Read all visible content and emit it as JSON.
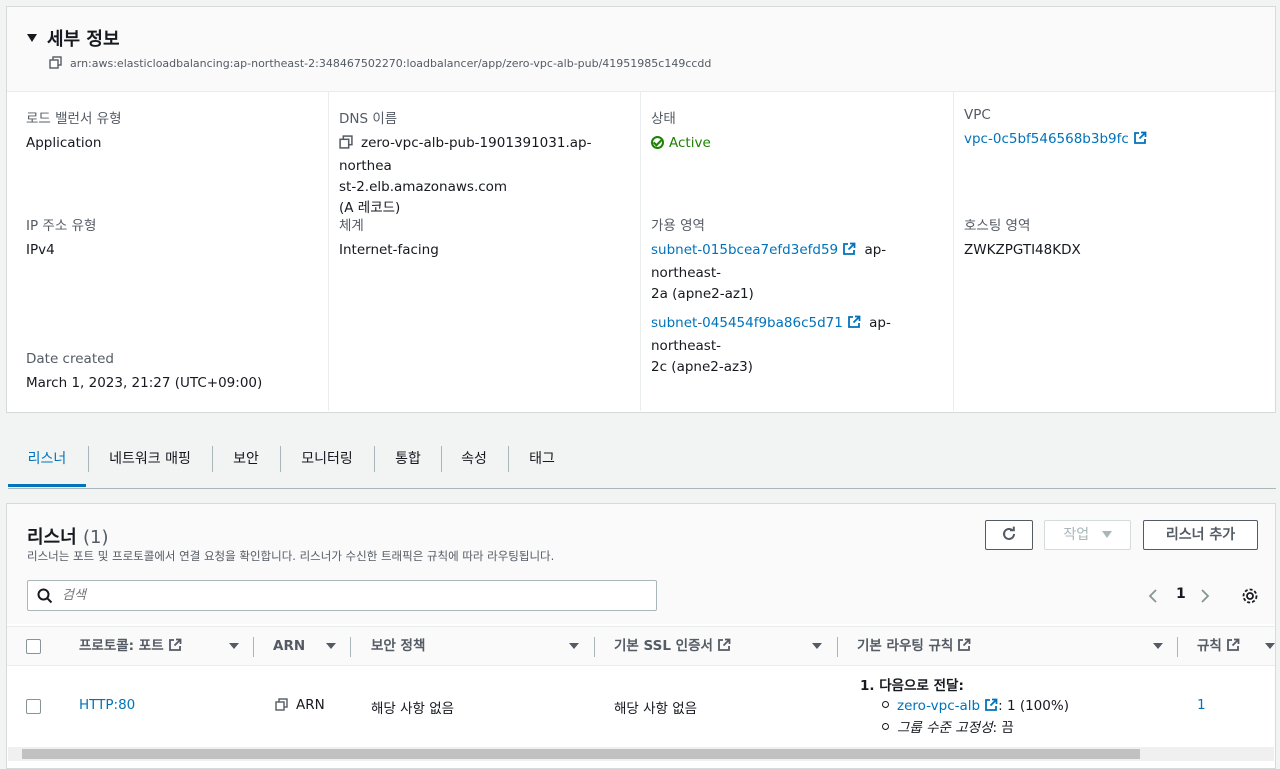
{
  "details": {
    "title": "세부 정보",
    "arn": "arn:aws:elasticloadbalancing:ap-northeast-2:348467502270:loadbalancer/app/zero-vpc-alb-pub/41951985c149ccdd",
    "lb_type_label": "로드 밸런서 유형",
    "lb_type_value": "Application",
    "dns_label": "DNS 이름",
    "dns_value_1": "zero-vpc-alb-pub-1901391031.ap-northea",
    "dns_value_2": "st-2.elb.amazonaws.com",
    "dns_value_3": "(A 레코드)",
    "status_label": "상태",
    "status_value": "Active",
    "vpc_label": "VPC",
    "vpc_value": "vpc-0c5bf546568b3b9fc",
    "ip_type_label": "IP 주소 유형",
    "ip_type_value": "IPv4",
    "scheme_label": "체계",
    "scheme_value": "Internet-facing",
    "az_label": "가용 영역",
    "az1_subnet": "subnet-015bcea7efd3efd59",
    "az1_suffix": "ap-northeast-",
    "az1_zone": "2a (apne2-az1)",
    "az2_subnet": "subnet-045454f9ba86c5d71",
    "az2_suffix": "ap-northeast-",
    "az2_zone": "2c (apne2-az3)",
    "hosted_zone_label": "호스팅 영역",
    "hosted_zone_value": "ZWKZPGTI48KDX",
    "date_label": "Date created",
    "date_value": "March 1, 2023, 21:27 (UTC+09:00)"
  },
  "tabs": [
    "리스너",
    "네트워크 매핑",
    "보안",
    "모니터링",
    "통합",
    "속성",
    "태그"
  ],
  "listeners": {
    "title": "리스너",
    "count": "(1)",
    "description": "리스너는 포트 및 프로토콜에서 연결 요청을 확인합니다. 리스너가 수신한 트래픽은 규칙에 따라 라우팅됩니다.",
    "actions_label": "작업",
    "add_label": "리스너 추가",
    "search_placeholder": "검색",
    "page": "1",
    "columns": {
      "protocol_port": "프로토콜: 포트",
      "arn": "ARN",
      "security_policy": "보안 정책",
      "ssl_cert": "기본 SSL 인증서",
      "routing": "기본 라우팅 규칙",
      "rules": "규칙"
    },
    "row": {
      "protocol_port": "HTTP:80",
      "arn": "ARN",
      "security_policy": "해당 사항 없음",
      "ssl_cert": "해당 사항 없음",
      "routing_heading": "1. 다음으로 전달:",
      "target_group": "zero-vpc-alb",
      "target_weight": ": 1 (100%)",
      "stickiness_label": "그룹 수준 고정성",
      "stickiness_value": ": 끔",
      "rules": "1"
    }
  },
  "colors": {
    "link": "#0073bb",
    "success": "#1d8102",
    "text": "#16191f",
    "muted": "#545b64"
  }
}
